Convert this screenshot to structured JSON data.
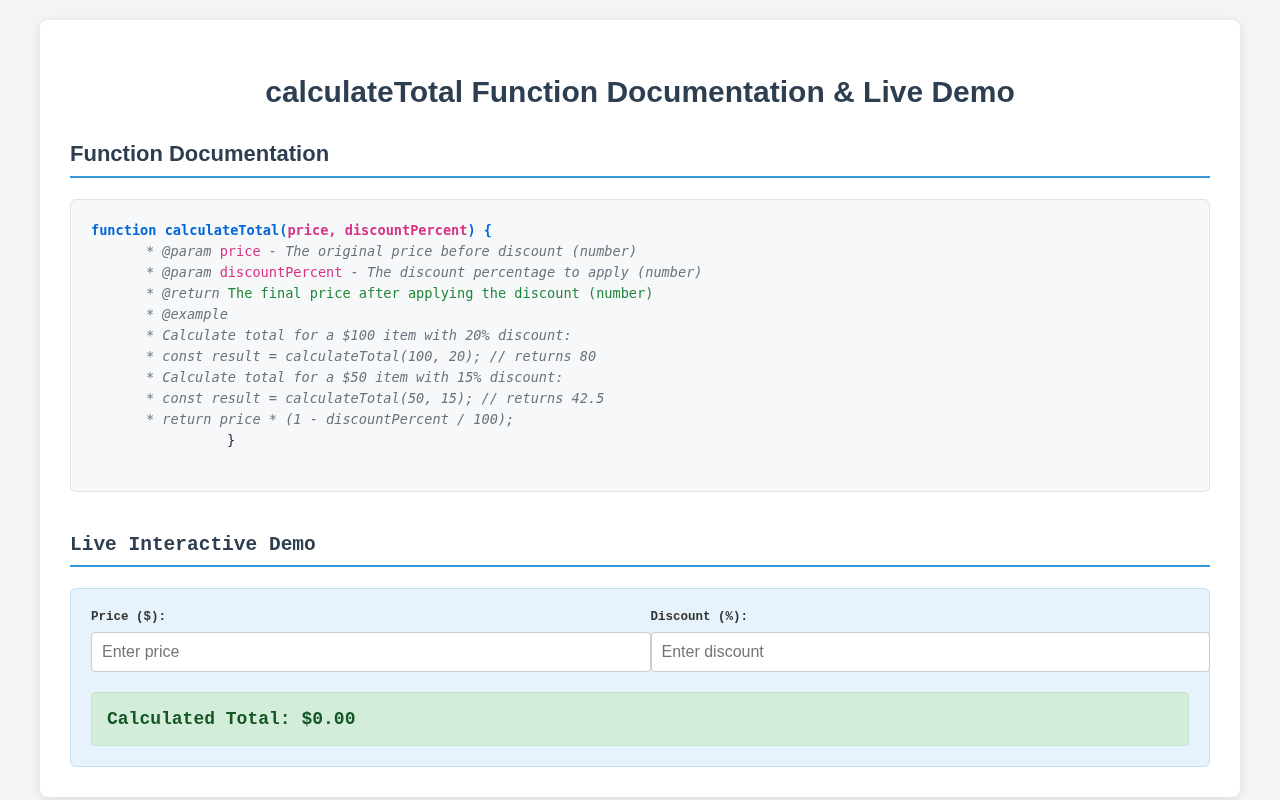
{
  "page": {
    "title": "calculateTotal Function Documentation & Live Demo"
  },
  "documentation": {
    "heading": "Function Documentation",
    "code_lines": [
      {
        "kind": "signature",
        "tokens": [
          {
            "text": "function calculateTotal(",
            "kind": "keyword"
          },
          {
            "text": "price, discountPercent",
            "kind": "param"
          },
          {
            "text": ") {",
            "kind": "keyword"
          }
        ]
      },
      {
        "kind": "doc",
        "tokens": [
          {
            "text": "* @param ",
            "kind": "comment"
          },
          {
            "text": "price",
            "kind": "reference"
          },
          {
            "text": " - The original price before discount (number)",
            "kind": "comment"
          }
        ]
      },
      {
        "kind": "doc",
        "tokens": [
          {
            "text": "* @param ",
            "kind": "comment"
          },
          {
            "text": "discountPercent",
            "kind": "reference"
          },
          {
            "text": " - The discount percentage to apply (number)",
            "kind": "comment"
          }
        ]
      },
      {
        "kind": "doc",
        "tokens": [
          {
            "text": "* @return ",
            "kind": "comment"
          },
          {
            "text": "The final price after applying the discount (number)",
            "kind": "returns"
          }
        ]
      },
      {
        "kind": "doc",
        "tokens": [
          {
            "text": "* @example",
            "kind": "comment"
          }
        ]
      },
      {
        "kind": "doc",
        "tokens": [
          {
            "text": "* Calculate total for a $100 item with 20% discount:",
            "kind": "comment"
          }
        ]
      },
      {
        "kind": "doc",
        "tokens": [
          {
            "text": "* const result = calculateTotal(100, 20); // returns 80",
            "kind": "comment"
          }
        ]
      },
      {
        "kind": "doc",
        "tokens": [
          {
            "text": "* Calculate total for a $50 item with 15% discount:",
            "kind": "comment"
          }
        ]
      },
      {
        "kind": "doc",
        "tokens": [
          {
            "text": "* const result = calculateTotal(50, 15); // returns 42.5",
            "kind": "comment"
          }
        ]
      },
      {
        "kind": "doc",
        "tokens": [
          {
            "text": "* return price * (1 - discountPercent / 100);",
            "kind": "comment"
          }
        ]
      },
      {
        "kind": "closing",
        "tokens": [
          {
            "text": "}",
            "kind": "plain"
          }
        ]
      }
    ]
  },
  "demo": {
    "heading": "Live Interactive Demo",
    "fields": [
      {
        "label": "Price ($):",
        "placeholder": "Enter price"
      },
      {
        "label": "Discount (%):",
        "placeholder": "Enter discount"
      }
    ],
    "result": "Calculated Total: $0.00"
  }
}
